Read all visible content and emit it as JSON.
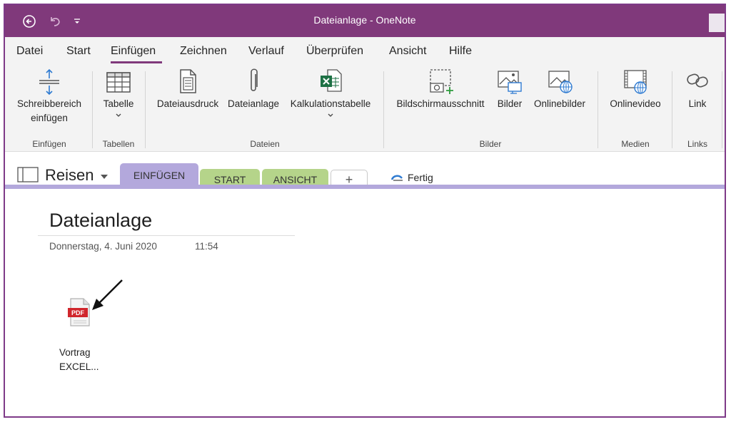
{
  "window": {
    "title": "Dateianlage - OneNote"
  },
  "menu": {
    "tabs": [
      {
        "label": "Datei"
      },
      {
        "label": "Start"
      },
      {
        "label": "Einfügen",
        "active": true
      },
      {
        "label": "Zeichnen"
      },
      {
        "label": "Verlauf"
      },
      {
        "label": "Überprüfen"
      },
      {
        "label": "Ansicht"
      },
      {
        "label": "Hilfe"
      }
    ]
  },
  "ribbon": {
    "buttons": {
      "insert_space": {
        "line1": "Schreibbereich",
        "line2": "einfügen",
        "icon": "insert-space-icon"
      },
      "table": {
        "label": "Tabelle",
        "icon": "table-icon"
      },
      "printout": {
        "label": "Dateiausdruck",
        "icon": "file-printout-icon"
      },
      "attachment": {
        "label": "Dateianlage",
        "icon": "paperclip-icon"
      },
      "spreadsheet": {
        "label": "Kalkulationstabelle",
        "icon": "excel-icon"
      },
      "screen_clipping": {
        "label": "Bildschirmausschnitt",
        "icon": "screen-clipping-icon"
      },
      "pictures": {
        "label": "Bilder",
        "icon": "pictures-icon"
      },
      "online_pictures": {
        "label": "Onlinebilder",
        "icon": "online-pictures-icon"
      },
      "online_video": {
        "label": "Onlinevideo",
        "icon": "online-video-icon"
      },
      "link": {
        "label": "Link",
        "icon": "link-icon"
      }
    },
    "groups": {
      "insert": "Einfügen",
      "tables": "Tabellen",
      "files": "Dateien",
      "images": "Bilder",
      "media": "Medien",
      "links": "Links"
    }
  },
  "sections": {
    "notebook": "Reisen",
    "tabs": [
      {
        "label": "EINFÜGEN",
        "color": "#b3a8dc",
        "active": true
      },
      {
        "label": "START",
        "color": "#b5d48a"
      },
      {
        "label": "ANSICHT",
        "color": "#b5d48a"
      },
      {
        "label": "+"
      }
    ],
    "sync_status": "Fertig"
  },
  "page": {
    "title": "Dateianlage",
    "date": "Donnerstag, 4. Juni 2020",
    "time": "11:54",
    "attachment": {
      "badge": "PDF",
      "name_line1": "Vortrag",
      "name_line2": "EXCEL..."
    }
  },
  "colors": {
    "accent": "#80397b",
    "section_einfuegen": "#b3a8dc",
    "section_green": "#b5d48a",
    "pdf_red": "#d0262c"
  }
}
